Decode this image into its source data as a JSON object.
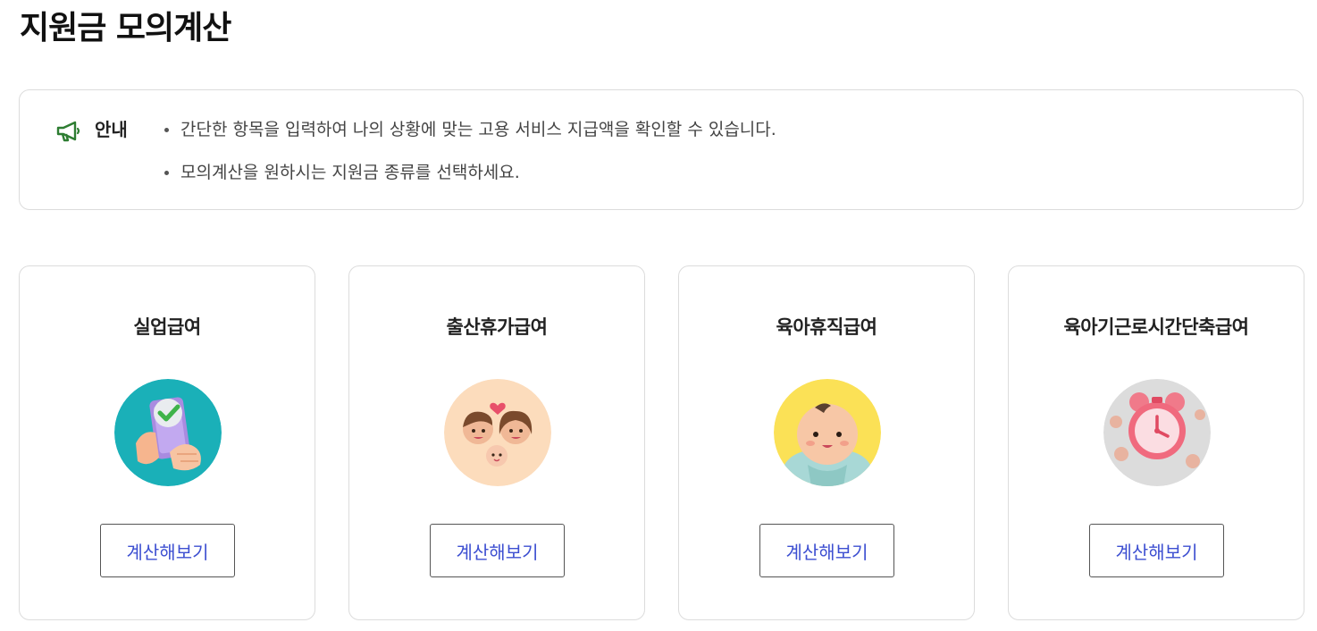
{
  "page": {
    "title": "지원금 모의계산"
  },
  "notice": {
    "icon": "megaphone-icon",
    "icon_color": "#2e7d32",
    "label": "안내",
    "items": [
      "간단한 항목을 입력하여 나의 상황에 맞는 고용 서비스 지급액을 확인할 수 있습니다.",
      "모의계산을 원하시는 지원금 종류를 선택하세요."
    ]
  },
  "cards": [
    {
      "title": "실업급여",
      "icon": "phone-check-icon",
      "icon_bg": "#1ab0b8",
      "button_label": "계산해보기"
    },
    {
      "title": "출산휴가급여",
      "icon": "family-icon",
      "icon_bg": "#fcdcbc",
      "button_label": "계산해보기"
    },
    {
      "title": "육아휴직급여",
      "icon": "baby-icon",
      "icon_bg": "#fbe156",
      "button_label": "계산해보기"
    },
    {
      "title": "육아기근로시간단축급여",
      "icon": "alarm-clock-coins-icon",
      "icon_bg": "#dcdcdc",
      "button_label": "계산해보기"
    }
  ],
  "colors": {
    "button_text": "#3d4fd1",
    "border": "#dcdcdc"
  }
}
